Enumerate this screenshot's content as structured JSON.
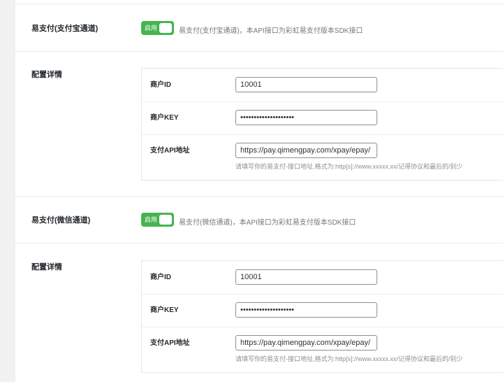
{
  "sections": [
    {
      "label": "易支付(支付宝通道)",
      "toggle_label": "启用",
      "description": "易支付(支付宝通道)，本API接口为彩虹易支付版本SDK接口",
      "config_label": "配置详情",
      "fields": {
        "merchant_id_label": "商户ID",
        "merchant_id_value": "10001",
        "merchant_key_label": "商户KEY",
        "merchant_key_value": "••••••••••••••••••••",
        "api_url_label": "支付API地址",
        "api_url_value": "https://pay.qimengpay.com/xpay/epay/",
        "api_url_hint": "请填写你的易支付-接口地址,格式为:http[s]://www.xxxxx.xx/记得协议和最后的/别少"
      }
    },
    {
      "label": "易支付(微信通道)",
      "toggle_label": "启用",
      "description": "易支付(微信通道)，本API接口为彩虹易支付版本SDK接口",
      "config_label": "配置详情",
      "fields": {
        "merchant_id_label": "商户ID",
        "merchant_id_value": "10001",
        "merchant_key_label": "商户KEY",
        "merchant_key_value": "••••••••••••••••••••",
        "api_url_label": "支付API地址",
        "api_url_value": "https://pay.qimengpay.com/xpay/epay/",
        "api_url_hint": "请填写你的易支付-接口地址,格式为:http[s]://www.xxxxx.xx/记得协议和最后的/别少"
      }
    }
  ],
  "colors": {
    "toggle_on": "#46b450",
    "background": "#f1f1f1"
  }
}
